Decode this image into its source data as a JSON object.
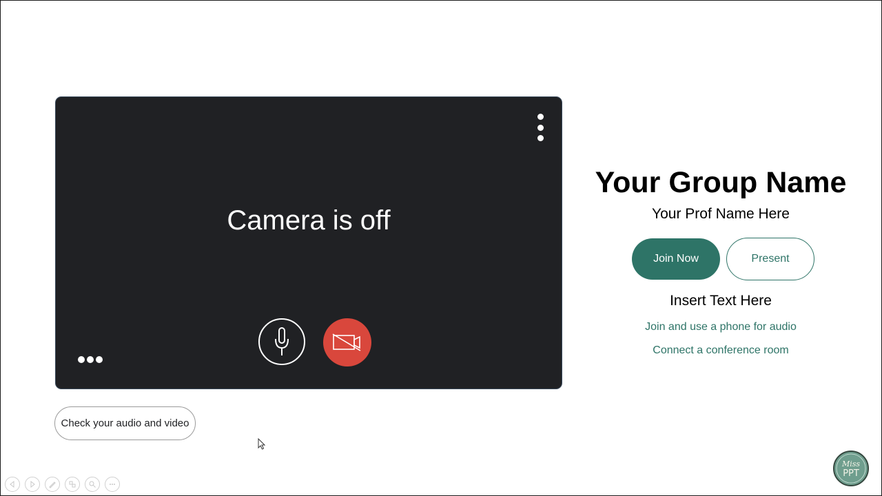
{
  "video_preview": {
    "status_text": "Camera is off"
  },
  "check_button": {
    "label": "Check your audio and video"
  },
  "join_pane": {
    "group_name": "Your Group Name",
    "prof_name": "Your Prof Name Here",
    "join_label": "Join Now",
    "present_label": "Present",
    "insert_text": "Insert Text Here",
    "phone_audio_link": "Join and use a phone for audio",
    "conference_link": "Connect a conference room"
  },
  "logo": {
    "line1": "Miss",
    "line2": "PPT"
  },
  "colors": {
    "panel_bg": "#202124",
    "accent_teal": "#2e7467",
    "camera_off_red": "#d9473c"
  },
  "icons": {
    "microphone": "microphone-icon",
    "camera_off": "camera-off-icon",
    "more_vertical": "more-vertical-icon",
    "more_horizontal": "more-horizontal-icon"
  }
}
